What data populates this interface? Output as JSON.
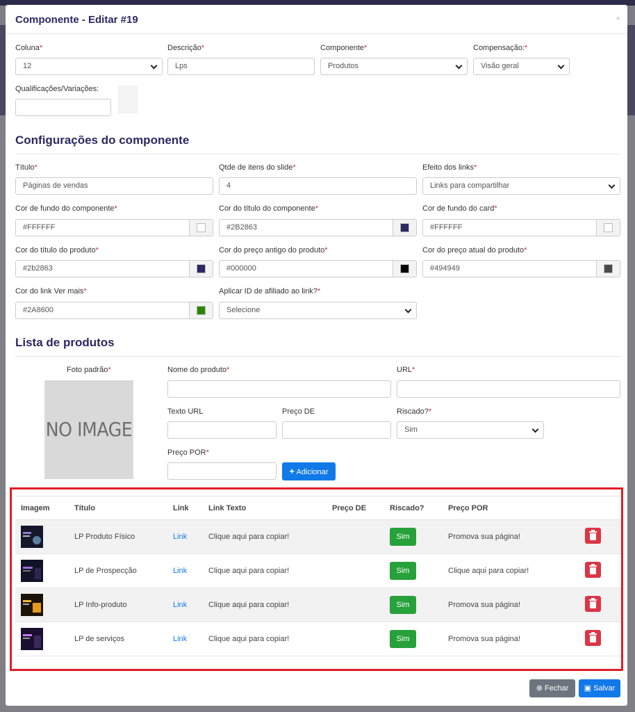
{
  "modal": {
    "title": "Componente - Editar #19",
    "close": "×"
  },
  "top_fields": {
    "coluna": {
      "label": "Coluna",
      "value": "12"
    },
    "descricao": {
      "label": "Descrição",
      "value": "Lps"
    },
    "componente": {
      "label": "Componente",
      "value": "Produtos"
    },
    "compensacao": {
      "label": "Compensação:",
      "value": "Visão geral"
    },
    "qualificacoes": {
      "label": "Qualificações/Variações:",
      "value": ""
    }
  },
  "config": {
    "section_title": "Configurações do componente",
    "titulo": {
      "label": "Título",
      "value": "Páginas de vendas"
    },
    "qtde": {
      "label": "Qtde de itens do slide",
      "value": "4"
    },
    "efeito": {
      "label": "Efeito dos links",
      "value": "Links para compartilhar"
    },
    "cor_fundo_comp": {
      "label": "Cor de fundo do componente",
      "value": "#FFFFFF",
      "swatch": "#FFFFFF"
    },
    "cor_titulo_comp": {
      "label": "Cor do título do componente",
      "value": "#2B2863",
      "swatch": "#2B2863"
    },
    "cor_fundo_card": {
      "label": "Cor de fundo do card",
      "value": "#FFFFFF",
      "swatch": "#FFFFFF"
    },
    "cor_titulo_prod": {
      "label": "Cor do título do produto",
      "value": "#2b2863",
      "swatch": "#2b2863"
    },
    "cor_preco_antigo": {
      "label": "Cor do preço antigo do produto",
      "value": "#000000",
      "swatch": "#000000"
    },
    "cor_preco_atual": {
      "label": "Cor do preço atual do produto",
      "value": "#494949",
      "swatch": "#494949"
    },
    "cor_link": {
      "label": "Cor do link Ver mais",
      "value": "#2A8600",
      "swatch": "#2A8600"
    },
    "aplicar_id": {
      "label": "Aplicar ID de afiliado ao link?",
      "value": "Selecione"
    }
  },
  "products_form": {
    "section_title": "Lista de produtos",
    "foto_label": "Foto padrão",
    "no_image": "NO IMAGE",
    "nome": {
      "label": "Nome do produto",
      "value": ""
    },
    "url": {
      "label": "URL",
      "value": ""
    },
    "texto_url": {
      "label": "Texto URL",
      "value": ""
    },
    "preco_de": {
      "label": "Preço DE",
      "value": ""
    },
    "riscado": {
      "label": "Riscado?",
      "value": "Sim"
    },
    "preco_por": {
      "label": "Preço POR",
      "value": ""
    },
    "add_button": "Adicionar"
  },
  "table": {
    "headers": [
      "Imagem",
      "Título",
      "Link",
      "Link Texto",
      "Preço DE",
      "Riscado?",
      "Preço POR",
      ""
    ],
    "rows": [
      {
        "titulo": "LP Produto Físico",
        "link": "Link",
        "link_texto": "Clique aqui para copiar!",
        "preco_de": "",
        "riscado": "Sim",
        "preco_por": "Promova sua página!"
      },
      {
        "titulo": "LP de Prospecção",
        "link": "Link",
        "link_texto": "Clique aqui para copiar!",
        "preco_de": "",
        "riscado": "Sim",
        "preco_por": "Clique aqui para copiar!"
      },
      {
        "titulo": "LP Info-produto",
        "link": "Link",
        "link_texto": "Clique aqui para copiar!",
        "preco_de": "",
        "riscado": "Sim",
        "preco_por": "Promova sua página!"
      },
      {
        "titulo": "LP de serviços",
        "link": "Link",
        "link_texto": "Clique aqui para copiar!",
        "preco_de": "",
        "riscado": "Sim",
        "preco_por": "Promova sua página!"
      }
    ]
  },
  "footer": {
    "close_button": "Fechar",
    "save_button": "Salvar"
  },
  "colors": {
    "brand": "#2b2863",
    "primary": "#1179e8",
    "success": "#27a13a",
    "danger": "#dc3545",
    "highlight": "#e01e26"
  }
}
